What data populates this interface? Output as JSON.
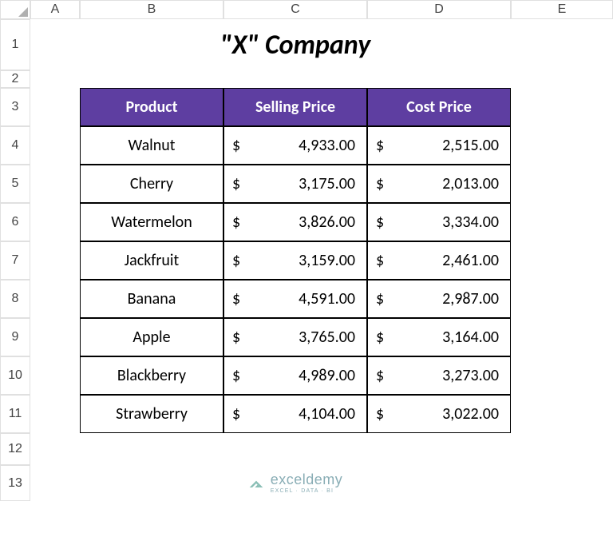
{
  "columns": [
    "A",
    "B",
    "C",
    "D",
    "E"
  ],
  "row_numbers": [
    "1",
    "2",
    "3",
    "4",
    "5",
    "6",
    "7",
    "8",
    "9",
    "10",
    "11",
    "12",
    "13"
  ],
  "title": "\"X\" Company",
  "headers": {
    "product": "Product",
    "selling": "Selling Price",
    "cost": "Cost Price"
  },
  "products": [
    {
      "name": "Walnut",
      "selling": "4,933.00",
      "cost": "2,515.00"
    },
    {
      "name": "Cherry",
      "selling": "3,175.00",
      "cost": "2,013.00"
    },
    {
      "name": "Watermelon",
      "selling": "3,826.00",
      "cost": "3,334.00"
    },
    {
      "name": "Jackfruit",
      "selling": "3,159.00",
      "cost": "2,461.00"
    },
    {
      "name": "Banana",
      "selling": "4,591.00",
      "cost": "2,987.00"
    },
    {
      "name": "Apple",
      "selling": "3,765.00",
      "cost": "3,164.00"
    },
    {
      "name": "Blackberry",
      "selling": "4,989.00",
      "cost": "3,273.00"
    },
    {
      "name": "Strawberry",
      "selling": "4,104.00",
      "cost": "3,022.00"
    }
  ],
  "currency_symbol": "$",
  "watermark": {
    "brand": "exceldemy",
    "sub": "EXCEL · DATA · BI"
  },
  "chart_data": {
    "type": "table",
    "title": "\"X\" Company",
    "columns": [
      "Product",
      "Selling Price",
      "Cost Price"
    ],
    "rows": [
      [
        "Walnut",
        4933.0,
        2515.0
      ],
      [
        "Cherry",
        3175.0,
        2013.0
      ],
      [
        "Watermelon",
        3826.0,
        3334.0
      ],
      [
        "Jackfruit",
        3159.0,
        2461.0
      ],
      [
        "Banana",
        4591.0,
        2987.0
      ],
      [
        "Apple",
        3765.0,
        3164.0
      ],
      [
        "Blackberry",
        4989.0,
        3273.0
      ],
      [
        "Strawberry",
        4104.0,
        3022.0
      ]
    ]
  }
}
